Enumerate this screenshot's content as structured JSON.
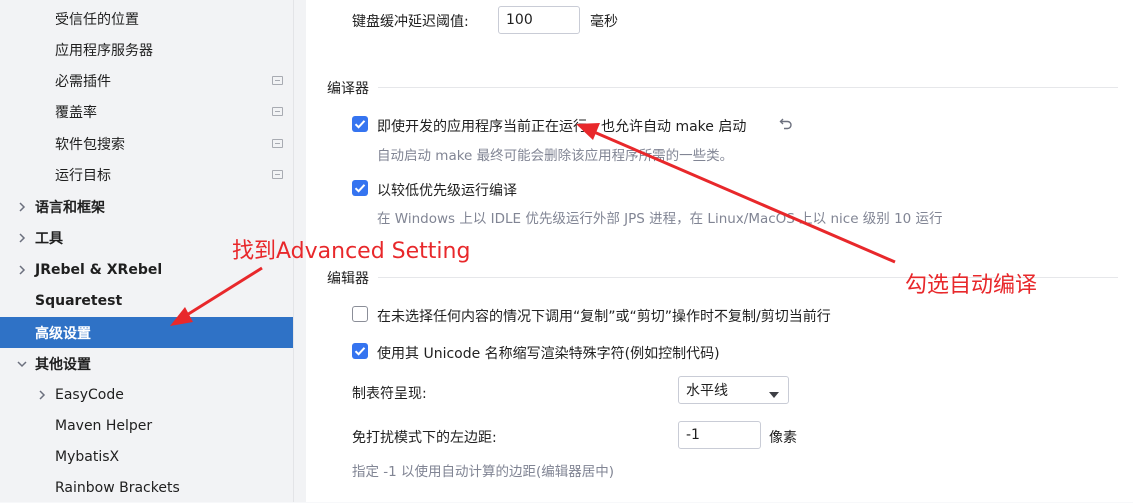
{
  "sidebar": {
    "items": [
      {
        "label": "受信任的位置"
      },
      {
        "label": "应用程序服务器"
      },
      {
        "label": "必需插件"
      },
      {
        "label": "覆盖率"
      },
      {
        "label": "软件包搜索"
      },
      {
        "label": "运行目标"
      },
      {
        "label": "语言和框架"
      },
      {
        "label": "工具"
      },
      {
        "label": "JRebel & XRebel"
      },
      {
        "label": "Squaretest"
      },
      {
        "label": "高级设置"
      },
      {
        "label": "其他设置"
      },
      {
        "label": "EasyCode"
      },
      {
        "label": "Maven Helper"
      },
      {
        "label": "MybatisX"
      },
      {
        "label": "Rainbow Brackets"
      }
    ]
  },
  "main": {
    "keyboard_delay_label": "键盘缓冲延迟阈值:",
    "keyboard_delay_value": "100",
    "keyboard_delay_unit": "毫秒",
    "compiler_section": "编译器",
    "compiler_opt1_label": "即使开发的应用程序当前正在运行，也允许自动 make 启动",
    "compiler_opt1_desc": "自动启动 make 最终可能会删除该应用程序所需的一些类。",
    "compiler_opt2_label": "以较低优先级运行编译",
    "compiler_opt2_desc": "在 Windows 上以 IDLE 优先级运行外部 JPS 进程，在 Linux/MacOS 上以 nice 级别 10 运行",
    "editor_section": "编辑器",
    "editor_opt1_label": "在未选择任何内容的情况下调用“复制”或“剪切”操作时不复制/剪切当前行",
    "editor_opt2_label": "使用其 Unicode 名称缩写渲染特殊字符(例如控制代码)",
    "tab_render_label": "制表符呈现:",
    "tab_render_value": "水平线",
    "left_margin_label": "免打扰模式下的左边距:",
    "left_margin_value": "-1",
    "left_margin_unit": "像素",
    "left_margin_hint": "指定 -1 以使用自动计算的边距(编辑器居中)"
  },
  "annotations": {
    "find_text": "找到Advanced Setting",
    "check_text": "勾选自动编译",
    "color": "#e8282b"
  },
  "colors": {
    "accent": "#3574f0",
    "selected_bg": "#2f72c6"
  }
}
